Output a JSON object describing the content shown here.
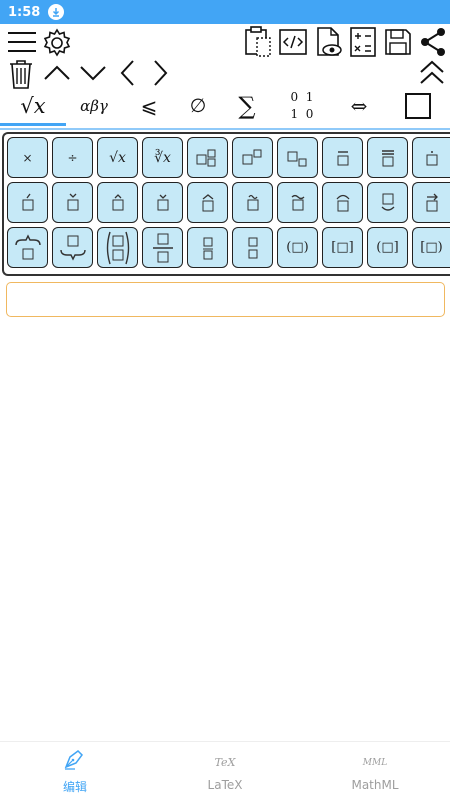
{
  "status_bar": {
    "time": "1:58"
  },
  "tabs": [
    {
      "label": "√x"
    },
    {
      "label": "αβγ"
    },
    {
      "label": "⩽"
    },
    {
      "label": "∅"
    },
    {
      "label": "∑"
    },
    {
      "label": "matrix"
    },
    {
      "label": "⇔"
    },
    {
      "label": "□"
    }
  ],
  "matrix_tab": {
    "r1": "0  1",
    "r2": "1  0"
  },
  "keypad": {
    "rows": [
      [
        "×",
        "÷",
        "√x",
        "∛x",
        "□^□□",
        "□^□",
        "□_□",
        "□̄",
        "□̿",
        "□̇"
      ],
      [
        "□́",
        "□̌",
        "□̂",
        "□̌",
        "□̂",
        "□̃",
        "□̃",
        "□̂",
        "□̆",
        "□⃗"
      ],
      [
        "⏞",
        "⏟",
        "(□/□)",
        "□/□",
        "□/□",
        "□/□",
        "(□)",
        "[□]",
        "(□]",
        "[□)"
      ]
    ]
  },
  "input": {
    "value": "",
    "placeholder": ""
  },
  "bottom_nav": [
    {
      "label": "编辑",
      "icon": "TeX"
    },
    {
      "label": "LaTeX",
      "icon": "TeX"
    },
    {
      "label": "MathML",
      "icon": "MML"
    }
  ],
  "colors": {
    "accent": "#42a5f5",
    "key_bg": "#c6e9f7",
    "inactive": "#9e9e9e"
  }
}
